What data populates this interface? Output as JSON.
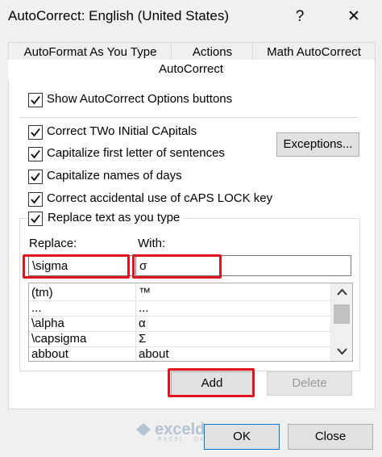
{
  "window": {
    "title": "AutoCorrect: English (United States)",
    "help_glyph": "?",
    "close_glyph": "✕"
  },
  "tabs": [
    {
      "label": "AutoFormat As You Type"
    },
    {
      "label": "Actions"
    },
    {
      "label": "Math AutoCorrect"
    }
  ],
  "active_tab": "AutoCorrect",
  "options": {
    "show_buttons": "Show AutoCorrect Options buttons",
    "two_initial_caps": "Correct TWo INitial CApitals",
    "capitalize_first": "Capitalize first letter of sentences",
    "capitalize_days": "Capitalize names of days",
    "caps_lock": "Correct accidental use of cAPS LOCK key",
    "replace_text": "Replace text as you type"
  },
  "exceptions_button": "Exceptions...",
  "replace": {
    "replace_label": "Replace:",
    "with_label": "With:",
    "replace_value": "\\sigma",
    "with_value": "σ"
  },
  "list_rows": [
    {
      "from": "(tm)",
      "to": "™"
    },
    {
      "from": "...",
      "to": "..."
    },
    {
      "from": "\\alpha",
      "to": "α"
    },
    {
      "from": "\\capsigma",
      "to": "Σ"
    },
    {
      "from": "abbout",
      "to": "about"
    }
  ],
  "buttons": {
    "add": "Add",
    "delete": "Delete",
    "ok": "OK",
    "close": "Close"
  },
  "watermark": {
    "name": "exceldemy",
    "tagline": "EXCEL · DATA · BI"
  },
  "colors": {
    "highlight": "#e0141e",
    "panel": "#ffffff",
    "dialog": "#f0f0f0"
  }
}
